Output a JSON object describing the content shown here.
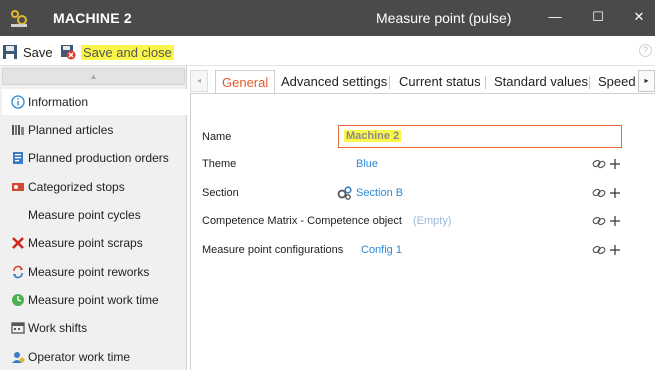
{
  "titlebar": {
    "app_name": "MACHINE 2",
    "window_title": "Measure point (pulse)",
    "minimize_glyph": "—",
    "maximize_glyph": "☐",
    "close_glyph": "✕",
    "bg_color": "#4a4a4a"
  },
  "toolbar": {
    "save_label": "Save",
    "save_close_label": "Save and close",
    "help_glyph": "?",
    "highlight_color": "#fbf64a"
  },
  "sidebar": {
    "scroll_up_glyph": "▲",
    "items": [
      {
        "label": "Information",
        "icon": "info-icon",
        "active": true
      },
      {
        "label": "Planned articles",
        "icon": "articles-icon"
      },
      {
        "label": "Planned production orders",
        "icon": "orders-icon"
      },
      {
        "label": "Categorized stops",
        "icon": "stops-icon"
      },
      {
        "label": "Measure point cycles",
        "icon": ""
      },
      {
        "label": "Measure point scraps",
        "icon": "scraps-icon"
      },
      {
        "label": "Measure point reworks",
        "icon": "reworks-icon"
      },
      {
        "label": "Measure point work time",
        "icon": "work-time-icon"
      },
      {
        "label": "Work shifts",
        "icon": "work-shifts-icon"
      },
      {
        "label": "Operator work time",
        "icon": "operator-icon"
      }
    ]
  },
  "tabs": {
    "scroll_left_glyph": "◂",
    "scroll_right_glyph": "▸",
    "items": [
      {
        "label": "General",
        "active": true
      },
      {
        "label": "Advanced settings"
      },
      {
        "label": "Current status"
      },
      {
        "label": "Standard values"
      },
      {
        "label": "Speed"
      }
    ],
    "active_color": "#e35b2d"
  },
  "form": {
    "name": {
      "label": "Name",
      "value": "Machine 2"
    },
    "theme": {
      "label": "Theme",
      "value": "Blue"
    },
    "section": {
      "label": "Section",
      "value": "Section B"
    },
    "competence": {
      "label": "Competence Matrix - Competence object",
      "value": "(Empty)"
    },
    "configs": {
      "label": "Measure point configurations",
      "value": "Config 1"
    },
    "link_color": "#2b89d6"
  }
}
